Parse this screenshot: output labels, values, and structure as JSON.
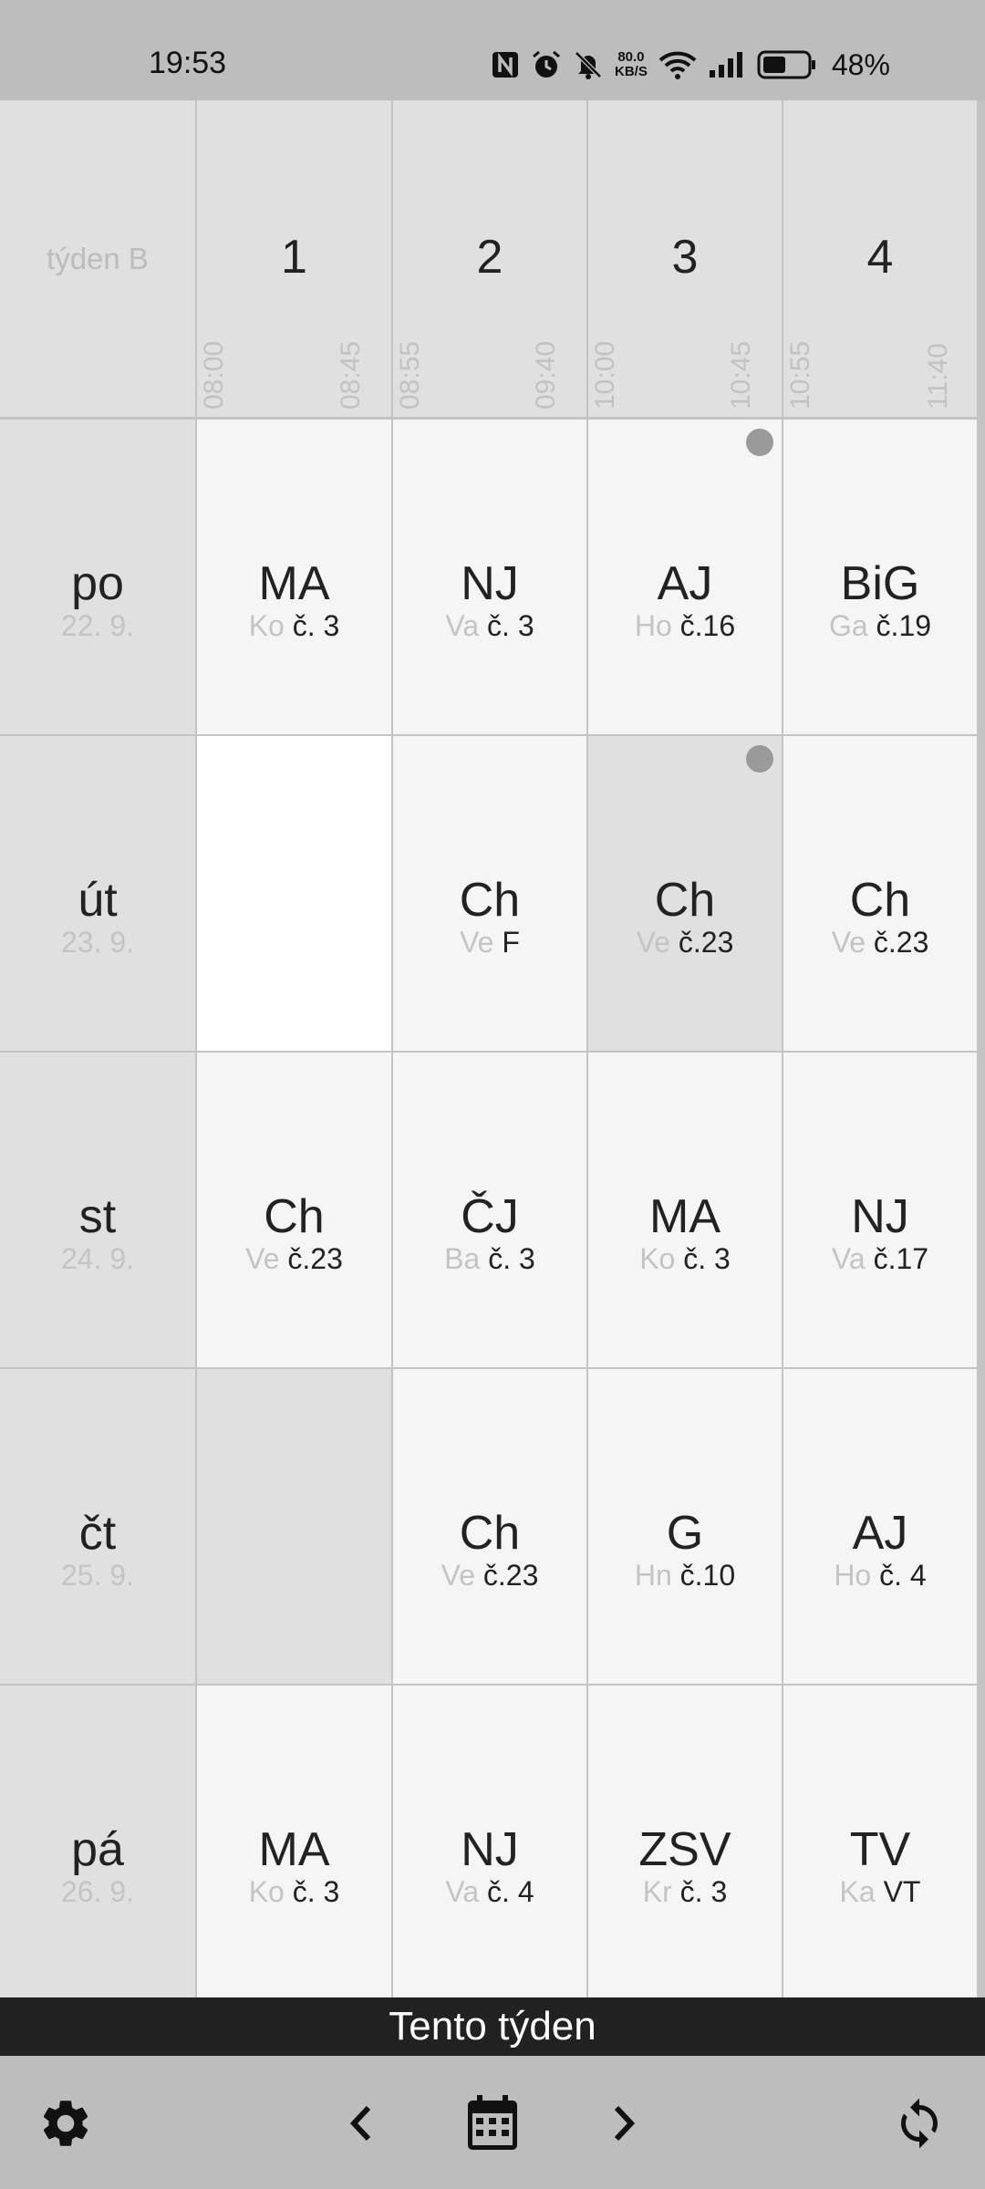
{
  "status_bar": {
    "time": "19:53",
    "net_speed_value": "80.0",
    "net_speed_unit": "KB/S",
    "battery_percent": "48%",
    "icons": [
      "nfc-icon",
      "alarm-icon",
      "mute-icon",
      "wifi-icon",
      "signal-icon",
      "battery-icon"
    ]
  },
  "timetable": {
    "week_label": "týden B",
    "periods": [
      {
        "number": "1",
        "start": "08:00",
        "end": "08:45"
      },
      {
        "number": "2",
        "start": "08:55",
        "end": "09:40"
      },
      {
        "number": "3",
        "start": "10:00",
        "end": "10:45"
      },
      {
        "number": "4",
        "start": "10:55",
        "end": "11:40"
      }
    ],
    "days": [
      {
        "name": "po",
        "date": "22. 9.",
        "lessons": [
          {
            "subject": "MA",
            "teacher": "Ko",
            "room": "č. 3"
          },
          {
            "subject": "NJ",
            "teacher": "Va",
            "room": "č. 3"
          },
          {
            "subject": "AJ",
            "teacher": "Ho",
            "room": "č.16",
            "marked": true
          },
          {
            "subject": "BiG",
            "teacher": "Ga",
            "room": "č.19"
          }
        ]
      },
      {
        "name": "út",
        "date": "23. 9.",
        "lessons": [
          {
            "empty": true,
            "style": "white"
          },
          {
            "subject": "Ch",
            "teacher": "Ve",
            "room": "F"
          },
          {
            "subject": "Ch",
            "teacher": "Ve",
            "room": "č.23",
            "marked": true,
            "highlighted": true
          },
          {
            "subject": "Ch",
            "teacher": "Ve",
            "room": "č.23"
          }
        ]
      },
      {
        "name": "st",
        "date": "24. 9.",
        "lessons": [
          {
            "subject": "Ch",
            "teacher": "Ve",
            "room": "č.23"
          },
          {
            "subject": "ČJ",
            "teacher": "Ba",
            "room": "č. 3"
          },
          {
            "subject": "MA",
            "teacher": "Ko",
            "room": "č. 3"
          },
          {
            "subject": "NJ",
            "teacher": "Va",
            "room": "č.17"
          }
        ]
      },
      {
        "name": "čt",
        "date": "25. 9.",
        "lessons": [
          {
            "empty": true,
            "style": "grey"
          },
          {
            "subject": "Ch",
            "teacher": "Ve",
            "room": "č.23"
          },
          {
            "subject": "G",
            "teacher": "Hn",
            "room": "č.10"
          },
          {
            "subject": "AJ",
            "teacher": "Ho",
            "room": "č. 4"
          }
        ]
      },
      {
        "name": "pá",
        "date": "26. 9.",
        "lessons": [
          {
            "subject": "MA",
            "teacher": "Ko",
            "room": "č. 3"
          },
          {
            "subject": "NJ",
            "teacher": "Va",
            "room": "č. 4"
          },
          {
            "subject": "ZSV",
            "teacher": "Kr",
            "room": "č. 3"
          },
          {
            "subject": "TV",
            "teacher": "Ka",
            "room": "VT"
          }
        ]
      }
    ]
  },
  "footer": {
    "current_week_label": "Tento týden",
    "buttons": [
      "gear-icon",
      "chevron-left-icon",
      "calendar-icon",
      "chevron-right-icon",
      "sync-icon"
    ]
  }
}
